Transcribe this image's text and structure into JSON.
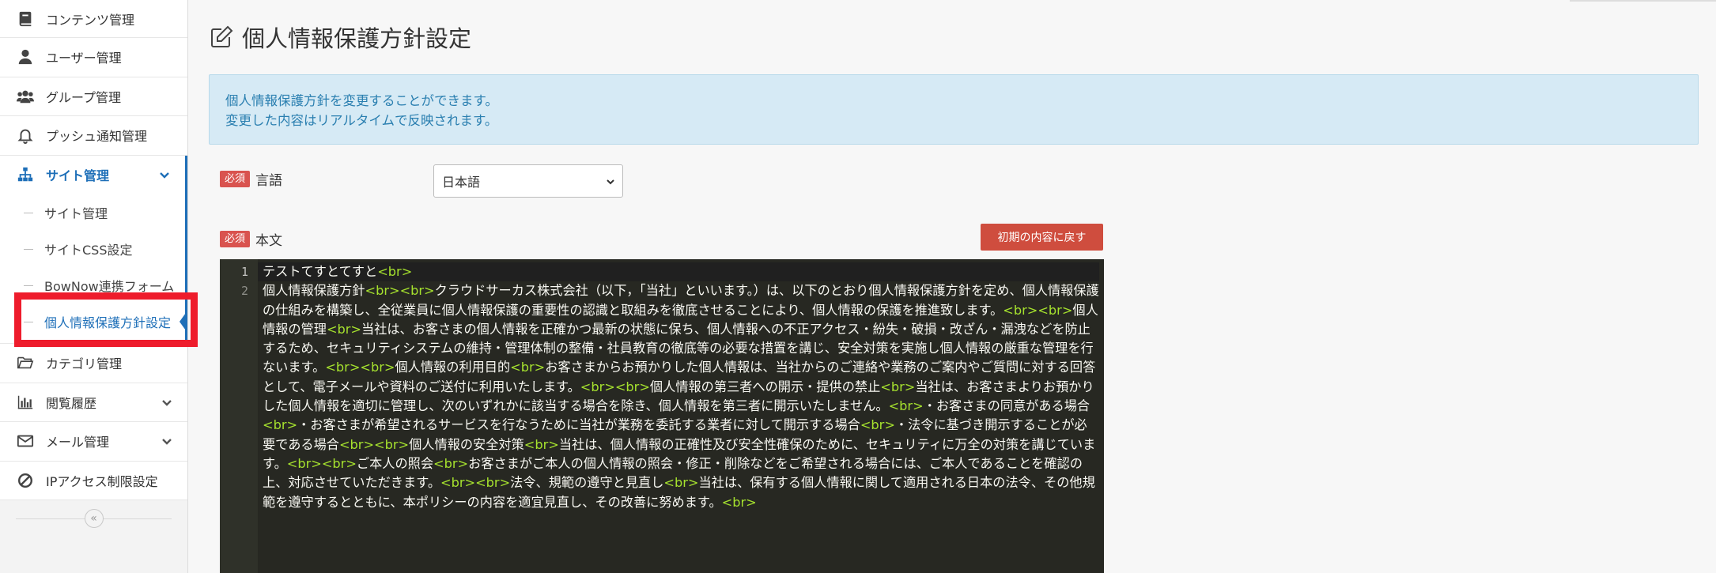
{
  "sidebar": {
    "items": [
      {
        "label": "コンテンツ管理",
        "icon": "book-icon"
      },
      {
        "label": "ユーザー管理",
        "icon": "user-icon"
      },
      {
        "label": "グループ管理",
        "icon": "users-icon"
      },
      {
        "label": "プッシュ通知管理",
        "icon": "bell-icon"
      },
      {
        "label": "サイト管理",
        "icon": "sitemap-icon"
      }
    ],
    "sub_items": [
      {
        "label": "サイト管理"
      },
      {
        "label": "サイトCSS設定"
      },
      {
        "label": "BowNow連携フォーム"
      },
      {
        "label": "個人情報保護方針設定"
      }
    ],
    "bottom_items": [
      {
        "label": "カテゴリ管理",
        "icon": "folder-icon"
      },
      {
        "label": "閲覧履歴",
        "icon": "bar-chart-icon"
      },
      {
        "label": "メール管理",
        "icon": "envelope-icon"
      },
      {
        "label": "IPアクセス制限設定",
        "icon": "ban-icon"
      }
    ],
    "collapse_label": "«"
  },
  "page": {
    "title": "個人情報保護方針設定",
    "info_line1": "個人情報保護方針を変更することができます。",
    "info_line2": "変更した内容はリアルタイムで反映されます。"
  },
  "form": {
    "required_label": "必須",
    "language_label": "言語",
    "language_value": "日本語",
    "body_label": "本文",
    "reset_button": "初期の内容に戻す",
    "line_numbers": [
      "1",
      "2"
    ],
    "code_line1": "テストてすとてすと<br>",
    "code_line2": "個人情報保護方針<br><br>クラウドサーカス株式会社（以下，「当社」といいます。）は、以下のとおり個人情報保護方針を定め、個人情報保護の仕組みを構築し、全従業員に個人情報保護の重要性の認識と取組みを徹底させることにより、個人情報の保護を推進致します。<br><br>個人情報の管理<br>当社は、お客さまの個人情報を正確かつ最新の状態に保ち、個人情報への不正アクセス・紛失・破損・改ざん・漏洩などを防止するため、セキュリティシステムの維持・管理体制の整備・社員教育の徹底等の必要な措置を講じ、安全対策を実施し個人情報の厳重な管理を行ないます。<br><br>個人情報の利用目的<br>お客さまからお預かりした個人情報は、当社からのご連絡や業務のご案内やご質問に対する回答として、電子メールや資料のご送付に利用いたします。<br><br>個人情報の第三者への開示・提供の禁止<br>当社は、お客さまよりお預かりした個人情報を適切に管理し、次のいずれかに該当する場合を除き、個人情報を第三者に開示いたしません。<br>・お客さまの同意がある場合<br>・お客さまが希望されるサービスを行なうために当社が業務を委託する業者に対して開示する場合<br>・法令に基づき開示することが必要である場合<br><br>個人情報の安全対策<br>当社は、個人情報の正確性及び安全性確保のために、セキュリティに万全の対策を講じています。<br><br>ご本人の照会<br>お客さまがご本人の個人情報の照会・修正・削除などをご希望される場合には、ご本人であることを確認の上、対応させていただきます。<br><br>法令、規範の遵守と見直し<br>当社は、保有する個人情報に関して適用される日本の法令、その他規範を遵守するとともに、本ポリシーの内容を適宜見直し、その改善に努めます。<br>"
  },
  "colors": {
    "accent": "#1e6fb8",
    "required": "#d9534f",
    "reset_button": "#cf4d3e",
    "highlight": "#ee1c2c",
    "editor_bg": "#272822",
    "tag": "#a6e22e"
  }
}
